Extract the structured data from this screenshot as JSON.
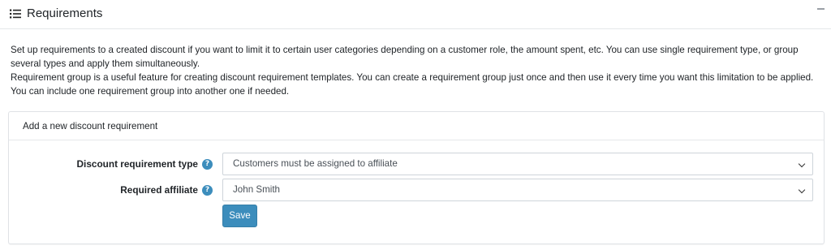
{
  "header": {
    "title": "Requirements",
    "icon": "list-icon",
    "collapse_icon": "minimize-icon"
  },
  "description": {
    "line1": "Set up requirements to a created discount if you want to limit it to certain user categories depending on a customer role, the amount spent, etc. You can use single requirement type, or group several types and apply them simultaneously.",
    "line2": "Requirement group is a useful feature for creating discount requirement templates. You can create a requirement group just once and then use it every time you want this limitation to be applied. You can include one requirement group into another one if needed."
  },
  "add_requirement": {
    "title": "Add a new discount requirement",
    "requirement_type": {
      "label": "Discount requirement type",
      "help_icon": "question-circle-icon",
      "value": "Customers must be assigned to affiliate"
    },
    "affiliate": {
      "label": "Required affiliate",
      "help_icon": "question-circle-icon",
      "value": "John Smith"
    },
    "save_label": "Save"
  },
  "colors": {
    "accent": "#3c8dbc",
    "border": "#dfe2e6",
    "text": "#212529"
  }
}
